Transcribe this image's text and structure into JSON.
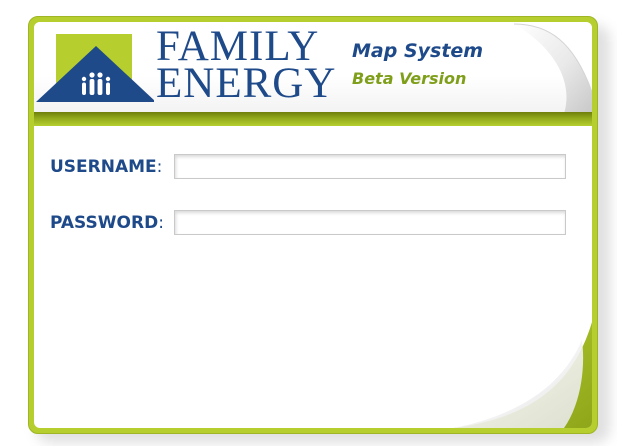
{
  "brand": {
    "line1": "FAMILY",
    "line2": "ENERGY",
    "logo_icon": "house-people-icon"
  },
  "product": {
    "name": "Map System",
    "version": "Beta Version"
  },
  "form": {
    "username_label": "USERNAME",
    "password_label": "PASSWORD",
    "label_suffix": ":",
    "username_value": "",
    "password_value": ""
  },
  "colors": {
    "brand_blue": "#1f4a8a",
    "accent_green": "#b6cf2f",
    "dark_green": "#6f7f0c",
    "version_green": "#7f9f1b"
  }
}
